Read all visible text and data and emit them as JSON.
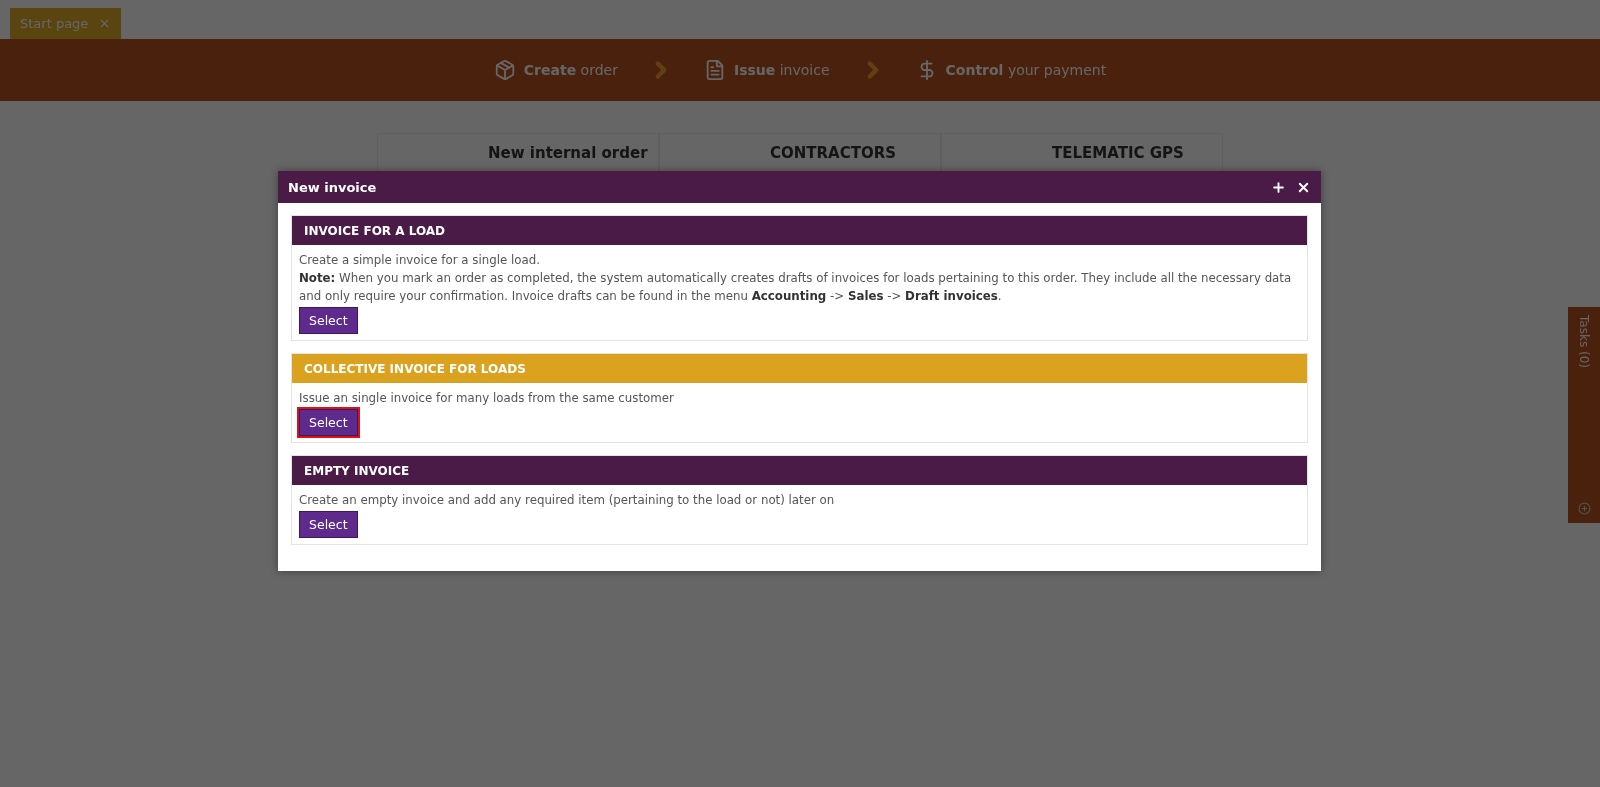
{
  "tabs": [
    {
      "label": "Start page",
      "selected": true
    }
  ],
  "steps": [
    {
      "kind": "box",
      "strong": "Create",
      "rest": "order"
    },
    {
      "kind": "doc",
      "strong": "Issue",
      "rest": "invoice"
    },
    {
      "kind": "dollar",
      "strong": "Control",
      "rest": "your payment"
    }
  ],
  "cards": [
    {
      "title": "New internal order"
    },
    {
      "title": "CONTRACTORS"
    },
    {
      "title": "TELEMATIC GPS"
    }
  ],
  "tasks_panel": {
    "label": "Tasks (0)"
  },
  "dialog": {
    "title": "New invoice",
    "sections": [
      {
        "title": "INVOICE FOR A LOAD",
        "selected": false,
        "lines": [
          "Create a simple invoice for a single load.",
          "**Note:** When you mark an order as completed, the system automatically creates drafts of invoices for loads pertaining to this order. They include all the necessary data and only require your confirmation. Invoice drafts can be found in the menu **Accounting** -> **Sales** -> **Draft invoices**."
        ],
        "button": "Select"
      },
      {
        "title": "COLLECTIVE INVOICE FOR LOADS",
        "selected": true,
        "lines": [
          "Issue an single invoice for many loads from the same customer"
        ],
        "button": "Select"
      },
      {
        "title": "EMPTY INVOICE",
        "selected": false,
        "lines": [
          "Create an empty invoice and add any required item (pertaining to the load or not) later on"
        ],
        "button": "Select"
      }
    ]
  }
}
